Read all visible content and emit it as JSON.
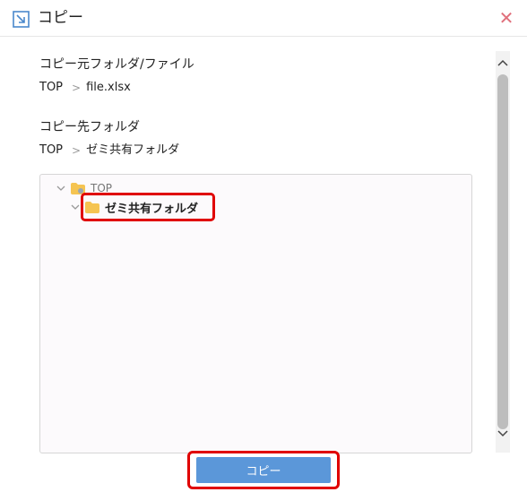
{
  "dialog": {
    "title": "コピー",
    "icon": "copy-dialog-icon",
    "close_icon": "close-icon",
    "accent_color": "#5b97d9",
    "close_color": "#e0707c",
    "highlight_color": "#e00000"
  },
  "source": {
    "label": "コピー元フォルダ/ファイル",
    "path": [
      "TOP",
      "file.xlsx"
    ]
  },
  "destination": {
    "label": "コピー先フォルダ",
    "path": [
      "TOP",
      "ゼミ共有フォルダ"
    ]
  },
  "tree": {
    "root": {
      "label": "TOP",
      "expanded": true
    },
    "children": [
      {
        "label": "ゼミ共有フォルダ",
        "selected": true
      }
    ]
  },
  "footer": {
    "copy_label": "コピー"
  }
}
